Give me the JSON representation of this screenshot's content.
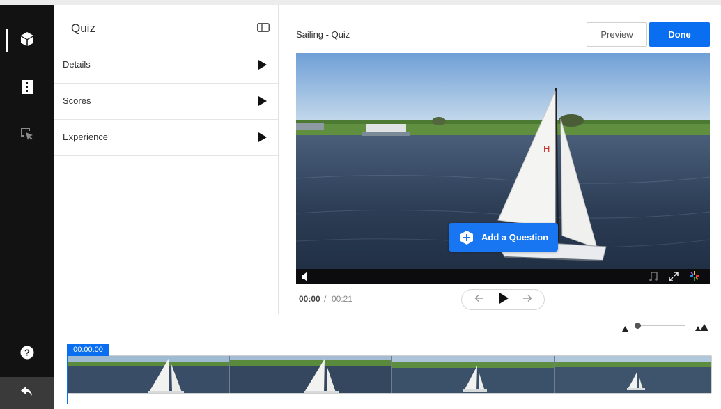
{
  "sidebar": {
    "items": [
      {
        "icon": "cube-icon",
        "active": true
      },
      {
        "icon": "chapters-icon",
        "active": false
      },
      {
        "icon": "cursor-select-icon",
        "active": false
      }
    ],
    "help_icon": "help-icon",
    "undo_icon": "undo-icon"
  },
  "panel": {
    "title": "Quiz",
    "toggle_icon": "panel-toggle-icon",
    "rows": [
      {
        "label": "Details"
      },
      {
        "label": "Scores"
      },
      {
        "label": "Experience"
      }
    ]
  },
  "header": {
    "video_title": "Sailing - Quiz",
    "preview_label": "Preview",
    "done_label": "Done"
  },
  "player": {
    "add_question_label": "Add a Question",
    "time_current": "00:00",
    "time_separator": "/",
    "time_total": "00:21",
    "controls": [
      "prev-arrow-icon",
      "play-icon",
      "next-arrow-icon"
    ],
    "bar_icons": [
      "volume-icon",
      "music-icon",
      "fullscreen-icon",
      "sparkle-icon"
    ]
  },
  "timeline": {
    "playhead_label": "00:00.00",
    "thumbnail_count": 4
  },
  "colors": {
    "accent": "#0a6ef0",
    "rail": "#121212"
  }
}
